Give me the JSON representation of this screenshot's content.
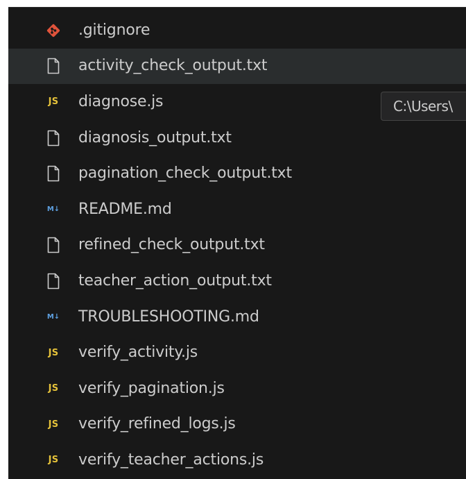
{
  "explorer": {
    "files": [
      {
        "name": ".gitignore",
        "icon": "git-icon"
      },
      {
        "name": "activity_check_output.txt",
        "icon": "file-icon"
      },
      {
        "name": "diagnose.js",
        "icon": "js-icon"
      },
      {
        "name": "diagnosis_output.txt",
        "icon": "file-icon"
      },
      {
        "name": "pagination_check_output.txt",
        "icon": "file-icon"
      },
      {
        "name": "README.md",
        "icon": "markdown-icon"
      },
      {
        "name": "refined_check_output.txt",
        "icon": "file-icon"
      },
      {
        "name": "teacher_action_output.txt",
        "icon": "file-icon"
      },
      {
        "name": "TROUBLESHOOTING.md",
        "icon": "markdown-icon"
      },
      {
        "name": "verify_activity.js",
        "icon": "js-icon"
      },
      {
        "name": "verify_pagination.js",
        "icon": "js-icon"
      },
      {
        "name": "verify_refined_logs.js",
        "icon": "js-icon"
      },
      {
        "name": "verify_teacher_actions.js",
        "icon": "js-icon"
      }
    ],
    "hovered_index": 1,
    "badges": {
      "js": "JS",
      "markdown": "M↓"
    }
  },
  "tooltip": {
    "text": "C:\\Users\\"
  },
  "colors": {
    "background": "#181818",
    "text": "#cccccc",
    "hover": "#2a2d2e",
    "js": "#e5c23a",
    "markdown": "#5ea0e0",
    "git": "#e0533b",
    "file_icon": "#cccccc"
  }
}
